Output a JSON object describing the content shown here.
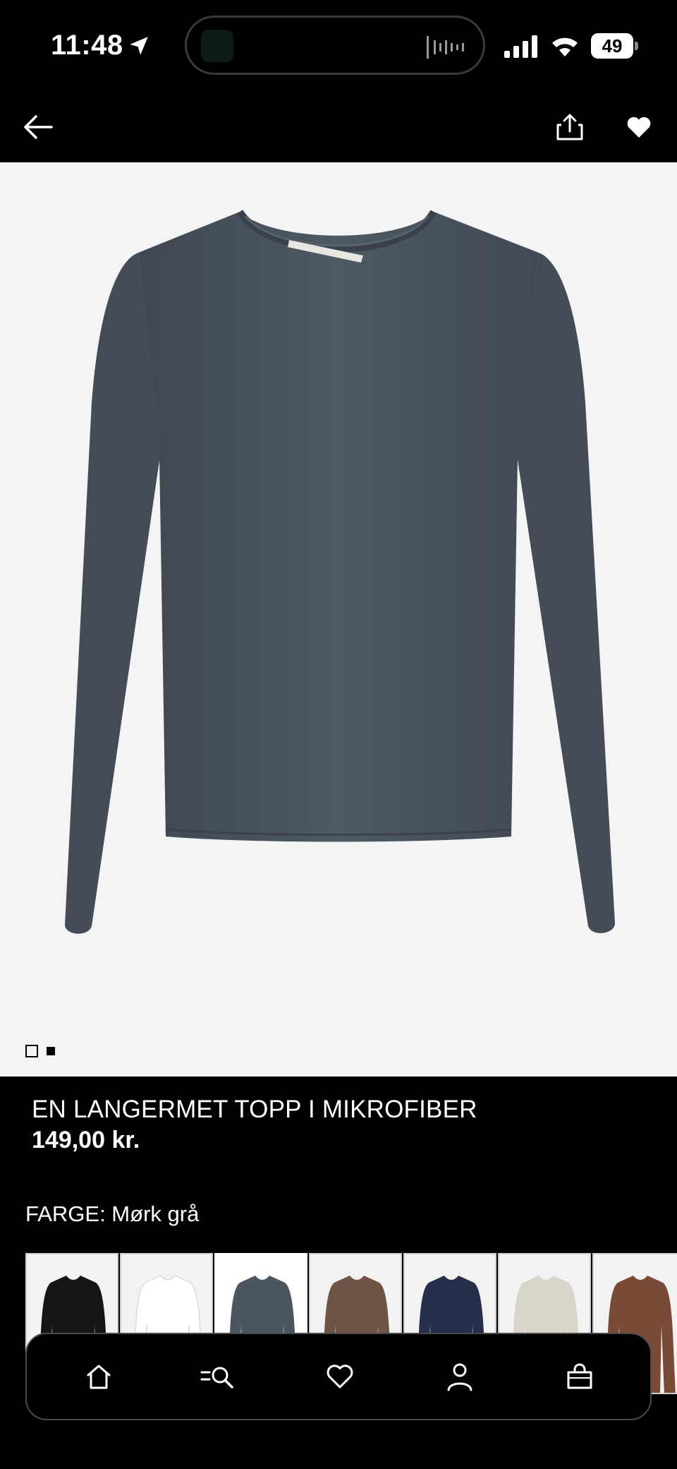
{
  "status_bar": {
    "time": "11:48",
    "battery": "49",
    "icons": [
      "location-arrow-icon",
      "dynamic-island",
      "signal-icon",
      "wifi-icon",
      "battery-icon"
    ]
  },
  "nav": {
    "back_icon": "arrow-left-icon",
    "share_icon": "share-icon",
    "favorite_icon": "heart-filled-icon"
  },
  "gallery": {
    "image": "dark grey long-sleeve top",
    "pages": 2,
    "current_page": 2
  },
  "product": {
    "title": "EN LANGERMET TOPP I MIKROFIBER",
    "price": "149,00 kr.",
    "color_label": "FARGE: Mørk grå"
  },
  "swatches": [
    {
      "color": "#151515",
      "selected": false
    },
    {
      "color": "#ffffff",
      "selected": false
    },
    {
      "color": "#4b5661",
      "selected": true
    },
    {
      "color": "#6e5444",
      "selected": false
    },
    {
      "color": "#26304a",
      "selected": false
    },
    {
      "color": "#d9d4ca",
      "selected": false
    },
    {
      "color": "#7a4a38",
      "selected": false
    }
  ],
  "tab_bar": {
    "items": [
      "home-icon",
      "search-menu-icon",
      "heart-outline-icon",
      "account-icon",
      "bag-icon"
    ]
  },
  "colors": {
    "background": "#000000",
    "image_background": "#f4f4f4",
    "garment": "#4b5661",
    "accent": "#ffffff"
  }
}
